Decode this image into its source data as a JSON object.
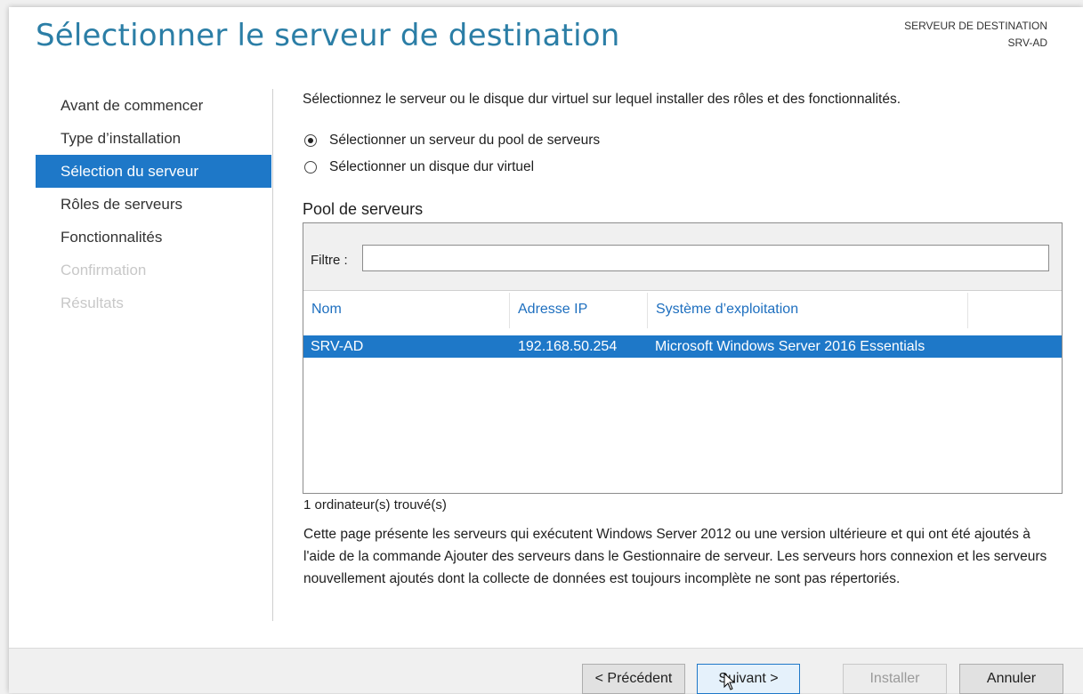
{
  "header": {
    "title": "Sélectionner le serveur de destination",
    "dest_label": "SERVEUR DE DESTINATION",
    "dest_value": "SRV-AD"
  },
  "nav": {
    "items": [
      {
        "label": "Avant de commencer",
        "state": "normal"
      },
      {
        "label": "Type d’installation",
        "state": "normal"
      },
      {
        "label": "Sélection du serveur",
        "state": "active"
      },
      {
        "label": "Rôles de serveurs",
        "state": "normal"
      },
      {
        "label": "Fonctionnalités",
        "state": "normal"
      },
      {
        "label": "Confirmation",
        "state": "disabled"
      },
      {
        "label": "Résultats",
        "state": "disabled"
      }
    ]
  },
  "main": {
    "intro": "Sélectionnez le serveur ou le disque dur virtuel sur lequel installer des rôles et des fonctionnalités.",
    "options": [
      {
        "label": "Sélectionner un serveur du pool de serveurs",
        "selected": true
      },
      {
        "label": "Sélectionner un disque dur virtuel",
        "selected": false
      }
    ],
    "pool_label": "Pool de serveurs",
    "filter_label": "Filtre :",
    "filter_value": "",
    "columns": [
      "Nom",
      "Adresse IP",
      "Système d’exploitation"
    ],
    "rows": [
      {
        "name": "SRV-AD",
        "ip": "192.168.50.254",
        "os": "Microsoft Windows Server 2016 Essentials"
      }
    ],
    "count": "1 ordinateur(s) trouvé(s)",
    "description": "Cette page présente les serveurs qui exécutent Windows Server 2012 ou une version ultérieure et qui ont été ajoutés à l'aide de la commande Ajouter des serveurs dans le Gestionnaire de serveur. Les serveurs hors connexion et les serveurs nouvellement ajoutés dont la collecte de données est toujours incomplète ne sont pas répertoriés."
  },
  "footer": {
    "prev": "< Précédent",
    "next": "Suivant >",
    "install": "Installer",
    "cancel": "Annuler"
  },
  "colors": {
    "accent": "#1e78c8",
    "title": "#2b7ea6"
  }
}
